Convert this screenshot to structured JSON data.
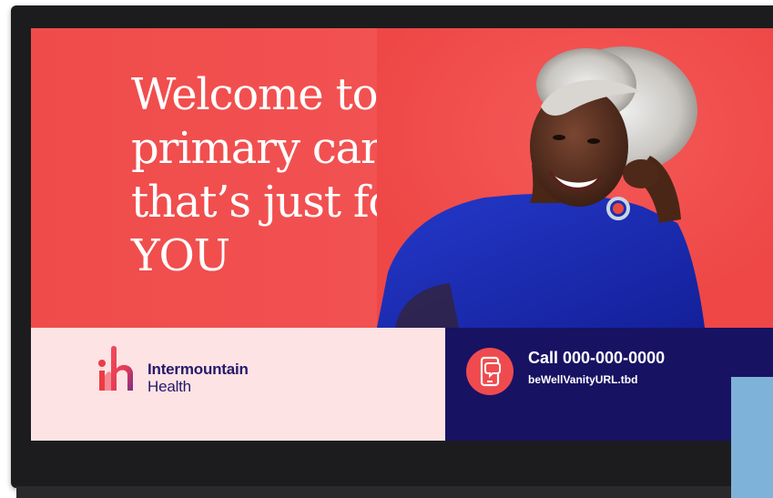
{
  "hero": {
    "headline_lines": [
      "Welcome to",
      "primary care",
      "that’s just for",
      "YOU"
    ]
  },
  "brand": {
    "name_line1": "Intermountain",
    "name_line2": "Health",
    "colors": {
      "logo_red": "#ee3b45",
      "logo_purple": "#251a6b",
      "panel_bg": "#fde3e4"
    }
  },
  "contact": {
    "call_label": "Call 000-000-0000",
    "url": "beWellVanityURL.tbd",
    "icon": "phone-chat-icon",
    "colors": {
      "panel_bg": "#181263",
      "badge_bg": "#ef4b4f"
    }
  },
  "theme": {
    "hero_bg": "#f04b4b",
    "shirt_blue": "#1d2fb8"
  }
}
